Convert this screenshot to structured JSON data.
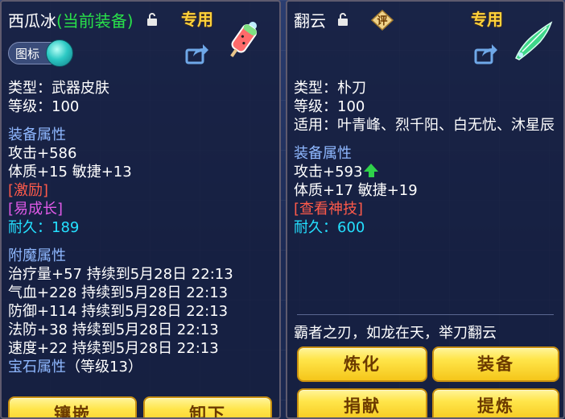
{
  "left": {
    "title_name": "西瓜冰",
    "title_status": "(当前装备)",
    "special": "专用",
    "toggle_label": "图标",
    "type_line": "类型：武器皮肤",
    "level_line": "等级：100",
    "equip_attr_header": "装备属性",
    "attack": "攻击+586",
    "stats": "体质+15 敏捷+13",
    "tag1": "[激励]",
    "tag2": "[易成长]",
    "durability": "耐久：189",
    "enchant_header": "附魔属性",
    "enchants": [
      "治疗量+57 持续到5月28日 22:13",
      "气血+228 持续到5月28日 22:13",
      "防御+114 持续到5月28日 22:13",
      "法防+38 持续到5月28日 22:13",
      "速度+22 持续到5月28日 22:13"
    ],
    "gem_header": "宝石属性",
    "gem_level": "（等级13）",
    "buttons": [
      "镶嵌",
      "卸下"
    ]
  },
  "right": {
    "title_name": "翻云",
    "eval_badge": "评",
    "special": "专用",
    "type_line": "类型：朴刀",
    "level_line": "等级：100",
    "apply_line": "适用：叶青峰、烈千阳、白无忧、沐星辰",
    "equip_attr_header": "装备属性",
    "attack": "攻击+593",
    "stats": "体质+17 敏捷+19",
    "skill_link": "[查看神技]",
    "durability": "耐久：600",
    "flavor": "霸者之刃，如龙在天，举刀翻云",
    "buttons": [
      "炼化",
      "装备",
      "捐献",
      "提炼"
    ]
  },
  "colors": {
    "gold_button": "#ffe54a",
    "attr_header": "#8fb8ff",
    "durability": "#24e0ff",
    "equipped": "#29e04a"
  }
}
